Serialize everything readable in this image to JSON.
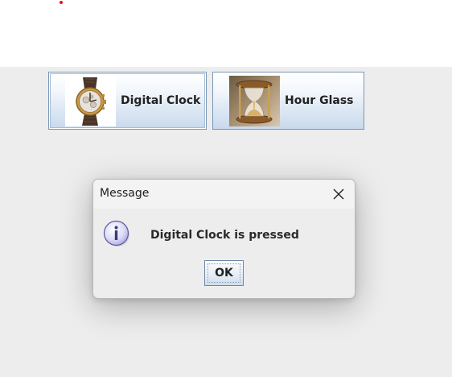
{
  "window": {
    "top_area_color": "#ffffff",
    "body_color": "#ededed",
    "marker_dot_color": "#e01818"
  },
  "toolbar": {
    "buttons": [
      {
        "label": "Digital Clock",
        "icon": "wristwatch-icon"
      },
      {
        "label": "Hour Glass",
        "icon": "hourglass-icon"
      }
    ]
  },
  "dialog": {
    "title": "Message",
    "close_icon": "close-icon",
    "info_icon": "information-icon",
    "message": "Digital Clock is pressed",
    "ok_label": "OK"
  }
}
